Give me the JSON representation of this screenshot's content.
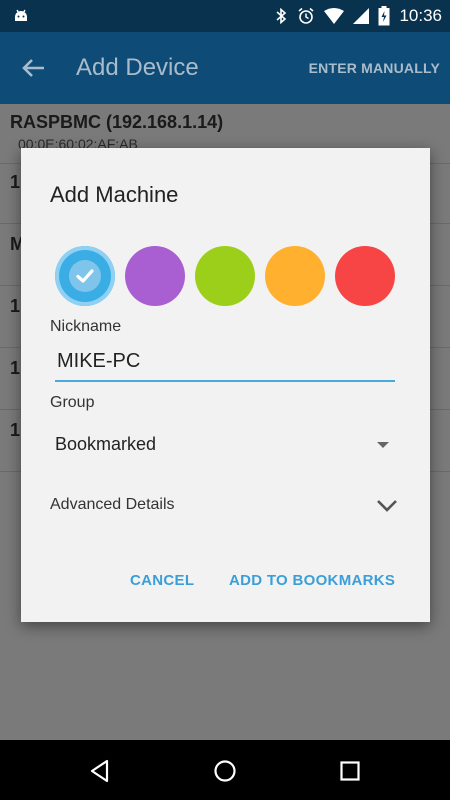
{
  "status_bar": {
    "time": "10:36"
  },
  "app_bar": {
    "title": "Add Device",
    "action_label": "ENTER MANUALLY"
  },
  "list": {
    "rows": [
      {
        "name": "RASPBMC (192.168.1.14)",
        "sub": "00:0E:60:02:AF:AB"
      },
      {
        "name": "1",
        "sub": ""
      },
      {
        "name": "M",
        "sub": ""
      },
      {
        "name": "1",
        "sub": ""
      },
      {
        "name": "1",
        "sub": ""
      },
      {
        "name": "1",
        "sub": ""
      }
    ]
  },
  "dialog": {
    "title": "Add Machine",
    "colors": [
      "#3aaee4",
      "#a95fd2",
      "#9ccf1a",
      "#ffb02e",
      "#f74545"
    ],
    "selected_color_index": 0,
    "nickname_label": "Nickname",
    "nickname_value": "MIKE-PC",
    "group_label": "Group",
    "group_value": "Bookmarked",
    "advanced_label": "Advanced Details",
    "cancel_label": "CANCEL",
    "add_label": "ADD TO BOOKMARKS"
  }
}
